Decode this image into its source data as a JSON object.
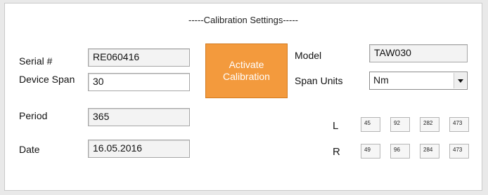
{
  "section_title": "-----Calibration Settings-----",
  "left": {
    "serial_label": "Serial #",
    "serial_value": "RE060416",
    "span_label": "Device Span",
    "span_value": "30",
    "period_label": "Period",
    "period_value": "365",
    "date_label": "Date",
    "date_value": "16.05.2016"
  },
  "activate_button": "Activate\nCalibration",
  "right": {
    "model_label": "Model",
    "model_value": "TAW030",
    "units_label": "Span Units",
    "units_value": "Nm"
  },
  "grid": {
    "L_label": "L",
    "L": [
      "45",
      "92",
      "282",
      "473"
    ],
    "R_label": "R",
    "R": [
      "49",
      "96",
      "284",
      "473"
    ]
  },
  "colors": {
    "accent": "#f39a3d"
  }
}
